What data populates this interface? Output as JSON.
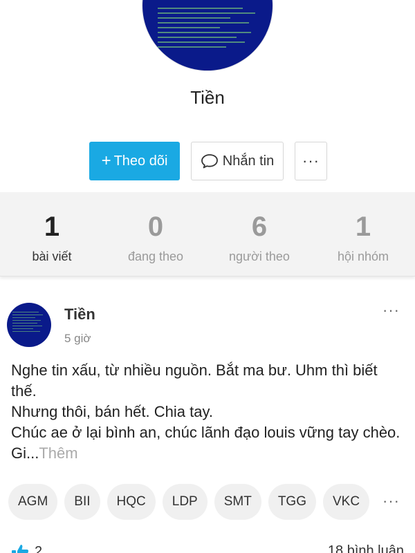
{
  "profile": {
    "name": "Tiền"
  },
  "actions": {
    "follow_label": "Theo dõi",
    "message_label": "Nhắn tin",
    "more_label": "···"
  },
  "stats": [
    {
      "count": "1",
      "label": "bài viết"
    },
    {
      "count": "0",
      "label": "đang theo"
    },
    {
      "count": "6",
      "label": "người theo"
    },
    {
      "count": "1",
      "label": "hội nhóm"
    }
  ],
  "post": {
    "author": "Tiền",
    "time": "5 giờ",
    "more_label": "···",
    "lines": [
      "Nghe tin xấu, từ nhiều nguồn. Bắt ma bư. Uhm thì biết thế.",
      "Nhưng thôi, bán hết. Chia tay.",
      "Chúc ae ở lại bình an, chúc lãnh đạo louis vững tay chèo. Gi..."
    ],
    "more_link": "Thêm",
    "tags": [
      "AGM",
      "BII",
      "HQC",
      "LDP",
      "SMT",
      "TGG",
      "VKC"
    ],
    "tags_more_label": "···",
    "likes": "2",
    "comments": "18 bình luận"
  },
  "colors": {
    "accent": "#1aa9e3",
    "avatar_bg": "#0a1a8a"
  }
}
